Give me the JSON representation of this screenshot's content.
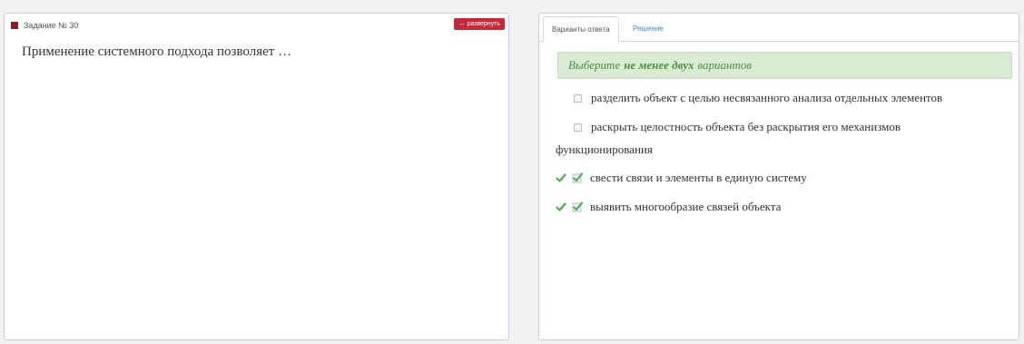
{
  "task": {
    "label": "Задание № 30",
    "expand_label": "развернуть",
    "question": "Применение системного подхода позволяет …"
  },
  "tabs": {
    "variants": "Варианты ответа",
    "solution": "Решение"
  },
  "hint": {
    "prefix": "Выберите",
    "emphasis": "не менее двух",
    "suffix": "вариантов"
  },
  "options": [
    {
      "text": "разделить объект с целью несвязанного анализа отдельных элементов",
      "checked": false
    },
    {
      "text": "раскрыть целостность объекта без раскрытия его механизмов",
      "continuation": "функционирования",
      "checked": false
    },
    {
      "text": "свести связи и элементы в единую систему",
      "checked": true,
      "correct": true
    },
    {
      "text": "выявить многообразие связей объекта",
      "checked": true,
      "correct": true
    }
  ],
  "colors": {
    "marker": "#8b1c24",
    "expand_button": "#c6283a",
    "hint_background": "#d9ecd3",
    "hint_text": "#4d8a43",
    "tab_link": "#3a8fd0",
    "check_green": "#4caf50"
  },
  "icons": {
    "correct": "green-checkmark-icon",
    "checked": "checked-checkbox-icon",
    "unchecked": "checkbox-icon"
  }
}
